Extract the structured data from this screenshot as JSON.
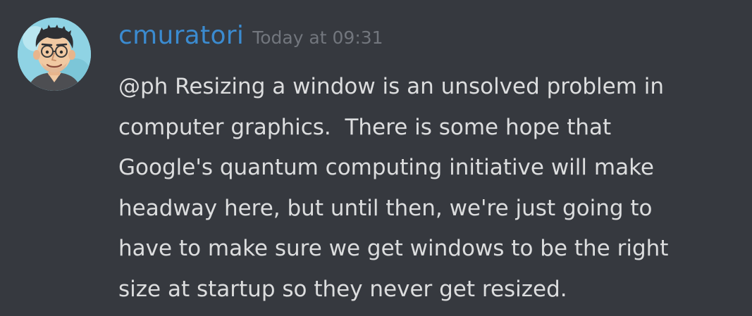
{
  "message": {
    "author": "cmuratori",
    "timestamp": "Today at 09:31",
    "lines": [
      "@ph Resizing a window is an unsolved problem in",
      "computer graphics.  There is some hope that",
      "Google's quantum computing initiative will make",
      "headway here, but until then, we're just going to",
      "have to make sure we get windows to be the right",
      "size at startup so they never get resized."
    ]
  },
  "colors": {
    "background": "#36393f",
    "username": "#3b8bd0",
    "timestamp": "#72767d",
    "text": "#dcddde"
  },
  "icons": {
    "avatar": "cartoon-avatar-man-glasses"
  }
}
